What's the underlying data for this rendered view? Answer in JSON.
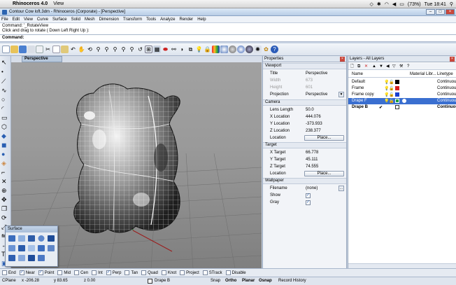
{
  "mac_menubar": {
    "app_name": "Rhinoceros 4.0",
    "menu": "View",
    "battery": "(73%)",
    "clock": "Tue 18:41"
  },
  "window": {
    "title": "Contour Cow loft.3dm - Rhinoceros (Corporate) - [Perspective]"
  },
  "menu": [
    "File",
    "Edit",
    "View",
    "Curve",
    "Surface",
    "Solid",
    "Mesh",
    "Dimension",
    "Transform",
    "Tools",
    "Analyze",
    "Render",
    "Help"
  ],
  "command": {
    "history_line1": "Command: '_RotateView",
    "history_line2": "Click and drag to rotate ( Down  Left  Right  Up ):",
    "prompt": "Command:"
  },
  "viewport": {
    "tab_label": "Perspective",
    "background_top": "#a3a3a3",
    "background_bottom": "#7c7c7c"
  },
  "properties": {
    "title": "Properties",
    "viewport_section": "Viewport",
    "viewport_rows": [
      {
        "key": "Title",
        "value": "Perspective",
        "gray": false
      },
      {
        "key": "Width",
        "value": "673",
        "gray": true
      },
      {
        "key": "Height",
        "value": "601",
        "gray": true
      },
      {
        "key": "Projection",
        "value": "Perspective",
        "gray": false
      }
    ],
    "camera_section": "Camera",
    "camera_rows": [
      {
        "key": "Lens Length",
        "value": "50.0"
      },
      {
        "key": "X Location",
        "value": "444.076"
      },
      {
        "key": "Y Location",
        "value": "-373.933"
      },
      {
        "key": "Z Location",
        "value": "238.377"
      },
      {
        "key": "Location",
        "value": "Place..."
      }
    ],
    "target_section": "Target",
    "target_rows": [
      {
        "key": "X Target",
        "value": "66.778"
      },
      {
        "key": "Y Target",
        "value": "45.111"
      },
      {
        "key": "Z Target",
        "value": "74.555"
      },
      {
        "key": "Location",
        "value": "Place..."
      }
    ],
    "wallpaper_section": "Wallpaper",
    "wallpaper_rows": [
      {
        "key": "Filename",
        "value": "(none)"
      },
      {
        "key": "Show",
        "value": "✓"
      },
      {
        "key": "Gray",
        "value": "✓"
      }
    ],
    "browse_label": "..."
  },
  "layers": {
    "title": "Layers - All Layers",
    "columns": [
      "Name",
      "Material Libr...",
      "Linetype"
    ],
    "rows": [
      {
        "name": "Default",
        "color": "#000000",
        "linetype": "Continuous",
        "current": false,
        "selected": false
      },
      {
        "name": "Frame",
        "color": "#d62020",
        "linetype": "Continuous",
        "current": false,
        "selected": false
      },
      {
        "name": "Frame copy",
        "color": "#1a3fd0",
        "linetype": "Continuous",
        "current": false,
        "selected": false
      },
      {
        "name": "Drape F",
        "color": "#1fa03a",
        "linetype": "Continuous",
        "current": false,
        "selected": true
      },
      {
        "name": "Drape B",
        "color": "#ffffff",
        "linetype": "Continuous",
        "current": true,
        "selected": false
      }
    ],
    "check_mark": "✔"
  },
  "surface_palette": {
    "title": "Surface"
  },
  "osnaps": [
    {
      "label": "End",
      "checked": false
    },
    {
      "label": "Near",
      "checked": true
    },
    {
      "label": "Point",
      "checked": true
    },
    {
      "label": "Mid",
      "checked": false
    },
    {
      "label": "Cen",
      "checked": false
    },
    {
      "label": "Int",
      "checked": false
    },
    {
      "label": "Perp",
      "checked": true
    },
    {
      "label": "Tan",
      "checked": false
    },
    {
      "label": "Quad",
      "checked": false
    },
    {
      "label": "Knot",
      "checked": false
    },
    {
      "label": "Project",
      "checked": false
    },
    {
      "label": "STrack",
      "checked": false
    },
    {
      "label": "Disable",
      "checked": false
    }
  ],
  "status": {
    "cplane": "CPlane",
    "x": "x -206.28",
    "y": "y 83.65",
    "z": "z 0.00",
    "layer": "Drape B",
    "snap": "Snap",
    "ortho": "Ortho",
    "planar": "Planar",
    "osnap": "Osnap",
    "record": "Record History"
  }
}
